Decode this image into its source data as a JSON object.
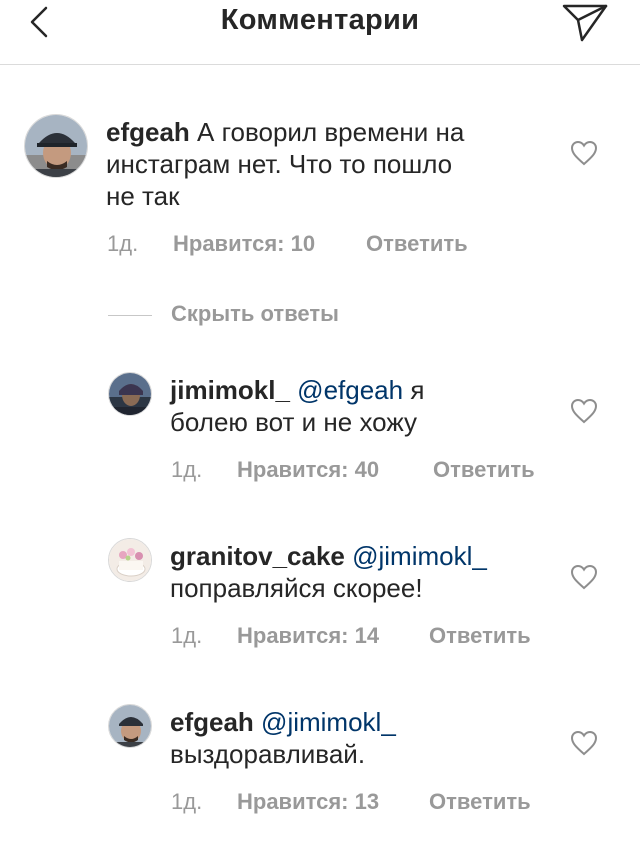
{
  "header": {
    "title": "Комментарии",
    "back_icon": "chevron-left-icon",
    "send_icon": "paper-plane-icon"
  },
  "colors": {
    "mention": "#003569",
    "meta": "#999999",
    "text": "#262626",
    "divider": "#dbdbdb"
  },
  "hide_replies_label": "Скрыть ответы",
  "comments": [
    {
      "username": "efgeah",
      "mention": "",
      "text": "А говорил времени на",
      "text_line2": "инстаграм нет. Что то пошло",
      "text_line3": "не так",
      "time": "1д.",
      "likes": "Нравится: 10",
      "reply": "Ответить"
    },
    {
      "username": "jimimokl_",
      "mention": "@efgeah",
      "text": "я",
      "text_line2": "болею вот и не хожу",
      "time": "1д.",
      "likes": "Нравится: 40",
      "reply": "Ответить"
    },
    {
      "username": "granitov_cake",
      "mention": "@jimimokl_",
      "text_line2": "поправляйся скорее!",
      "time": "1д.",
      "likes": "Нравится: 14",
      "reply": "Ответить"
    },
    {
      "username": "efgeah",
      "mention": "@jimimokl_",
      "text_line2": "выздоравливай.",
      "time": "1д.",
      "likes": "Нравится: 13",
      "reply": "Ответить"
    }
  ]
}
